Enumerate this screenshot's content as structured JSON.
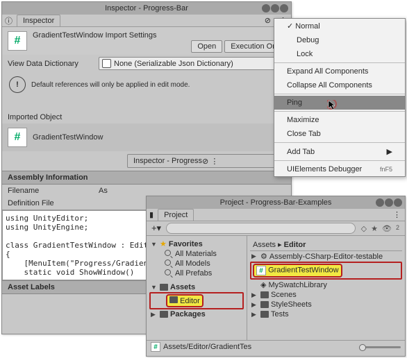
{
  "inspector": {
    "windowTitle": "Inspector - Progress-Bar",
    "tabLabel": "Inspector",
    "heading": "GradientTestWindow Import Settings",
    "openBtn": "Open",
    "execBtn": "Execution Ord",
    "viewDataLabel": "View Data Dictionary",
    "viewDataValue": "None (Serializable Json Dictionary)",
    "infoMsg": "Default references will only be applied in edit mode.",
    "importedSection": "Imported Object",
    "importedName": "GradientTestWindow",
    "secondTab": "Inspector - Progress",
    "asmInfo": "Assembly Information",
    "filenameLabel": "Filename",
    "filenameValue": "As",
    "defFileLabel": "Definition File",
    "code": "using UnityEditor;\nusing UnityEngine;\n\nclass GradientTestWindow : EditorW\n{\n    [MenuItem(\"Progress/GradientTe\n    static void ShowWindow()",
    "assetLabels": "Asset Labels"
  },
  "menu": {
    "normal": "Normal",
    "debug": "Debug",
    "lock": "Lock",
    "expand": "Expand All Components",
    "collapse": "Collapse All Components",
    "ping": "Ping",
    "maximize": "Maximize",
    "closeTab": "Close Tab",
    "addTab": "Add Tab",
    "uidbg": "UIElements Debugger",
    "uidbgKey": "fnF5"
  },
  "project": {
    "windowTitle": "Project - Progress-Bar-Examples",
    "tabLabel": "Project",
    "favorites": "Favorites",
    "allMaterials": "All Materials",
    "allModels": "All Models",
    "allPrefabs": "All Prefabs",
    "assets": "Assets",
    "editor": "Editor",
    "packages": "Packages",
    "crumbAssets": "Assets",
    "crumbEditor": "Editor",
    "items": {
      "i0": "Assembly-CSharp-Editor-testable",
      "i1": "GradientTestWindow",
      "i2": "MySwatchLibrary",
      "i3": "Scenes",
      "i4": "StyleSheets",
      "i5": "Tests"
    },
    "footerPath": "Assets/Editor/GradientTes"
  }
}
